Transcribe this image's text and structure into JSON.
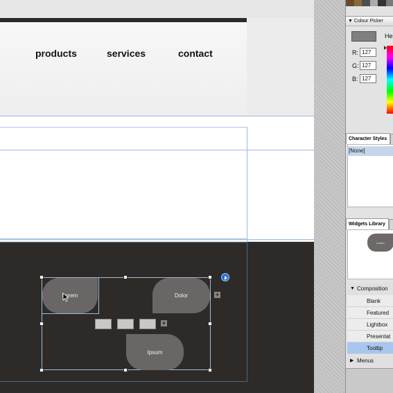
{
  "nav": {
    "items": [
      "products",
      "services",
      "contact"
    ]
  },
  "widget": {
    "tab_lorem": "Lorem",
    "tab_dolor": "Dolor",
    "tab_ipsum": "Ipsum"
  },
  "colour_picker": {
    "title": "Colour Picker",
    "hex_label": "He",
    "r_label": "R:",
    "g_label": "G:",
    "b_label": "B:",
    "r": "127",
    "g": "127",
    "b": "127",
    "swatch_color": "#7f7f7f"
  },
  "character_styles": {
    "title": "Character Styles",
    "selected": "[None]"
  },
  "widgets_library": {
    "title": "Widgets Library",
    "thumb_label": "Lorem",
    "composition_folder": "Composition",
    "items": [
      "Blank",
      "Featured",
      "Lightbox",
      "Presentat",
      "Tooltip"
    ],
    "selected_index": 4,
    "menus_folder": "Menus"
  },
  "colors": {
    "footer_bg": "#2d2a28",
    "widget_gray": "#6a6665",
    "guide_blue": "#9ab9de",
    "selection_blue": "#a9c6ee"
  }
}
